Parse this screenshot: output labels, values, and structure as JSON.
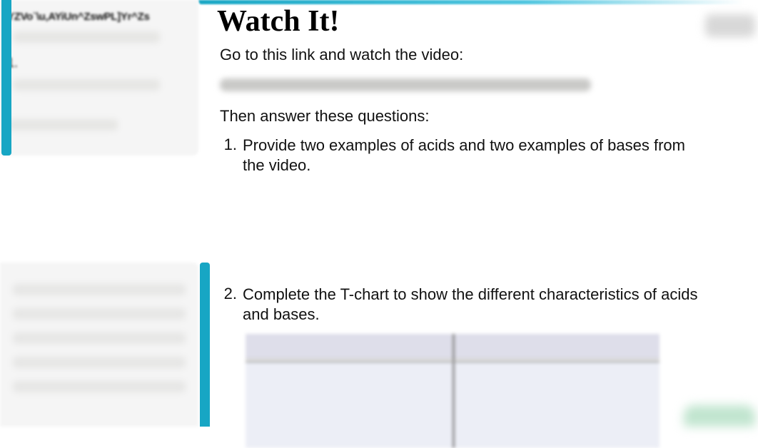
{
  "leftPanel": {
    "title": "YZVo`\\u,AYiUn^ZswPL]Yr^Zs",
    "listNumber": "1."
  },
  "main": {
    "title": "Watch It!",
    "intro": "Go to this link and watch the video:",
    "followup": "Then answer these questions:",
    "questions": [
      {
        "num": "1.",
        "text": "Provide two examples of acids and two examples of bases from the video."
      },
      {
        "num": "2.",
        "text": "Complete the T-chart to show the different characteristics of acids and bases."
      }
    ]
  }
}
